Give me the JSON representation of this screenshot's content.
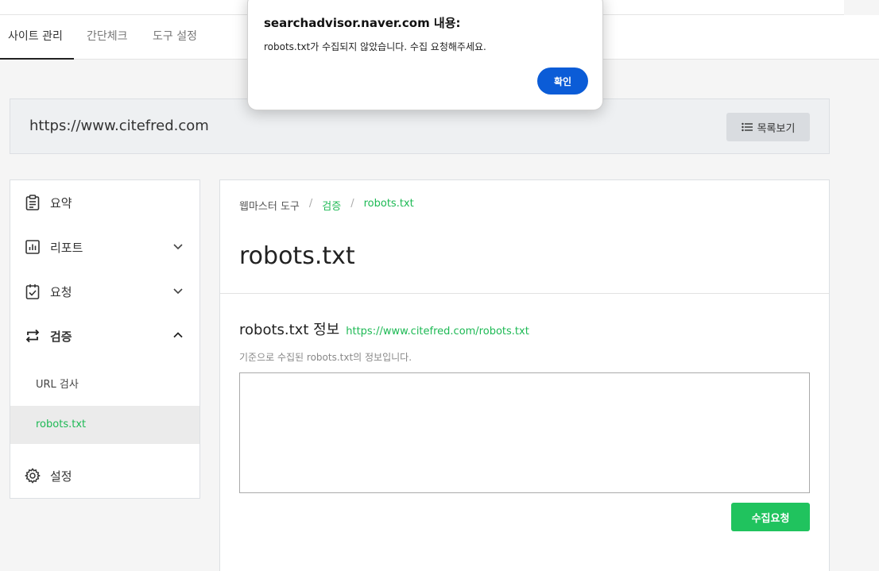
{
  "tabs": [
    {
      "label": "사이트 관리",
      "active": true
    },
    {
      "label": "간단체크",
      "active": false
    },
    {
      "label": "도구 설정",
      "active": false
    }
  ],
  "site": {
    "url": "https://www.citefred.com",
    "list_button": "목록보기"
  },
  "sidebar": {
    "items": [
      {
        "label": "요약",
        "icon": "clipboard-icon"
      },
      {
        "label": "리포트",
        "icon": "chart-icon"
      },
      {
        "label": "요청",
        "icon": "checklist-icon"
      },
      {
        "label": "검증",
        "icon": "swap-icon"
      },
      {
        "label": "설정",
        "icon": "gear-icon"
      }
    ],
    "sub_items": [
      {
        "label": "URL 검사",
        "active": false
      },
      {
        "label": "robots.txt",
        "active": true
      }
    ]
  },
  "main": {
    "breadcrumb": [
      "웹마스터 도구",
      "검증",
      "robots.txt"
    ],
    "title": "robots.txt",
    "section_title": "robots.txt 정보",
    "section_link": "https://www.citefred.com/robots.txt",
    "description": "기준으로 수집된 robots.txt의 정보입니다.",
    "textbox_value": "",
    "request_button": "수집요청"
  },
  "dialog": {
    "title": "searchadvisor.naver.com 내용:",
    "message": "robots.txt가 수집되지 않았습니다. 수집 요청해주세요.",
    "ok_button": "확인"
  },
  "colors": {
    "accent_green": "#1db954",
    "button_green": "#20c35e",
    "dialog_blue": "#0b5cd7"
  }
}
